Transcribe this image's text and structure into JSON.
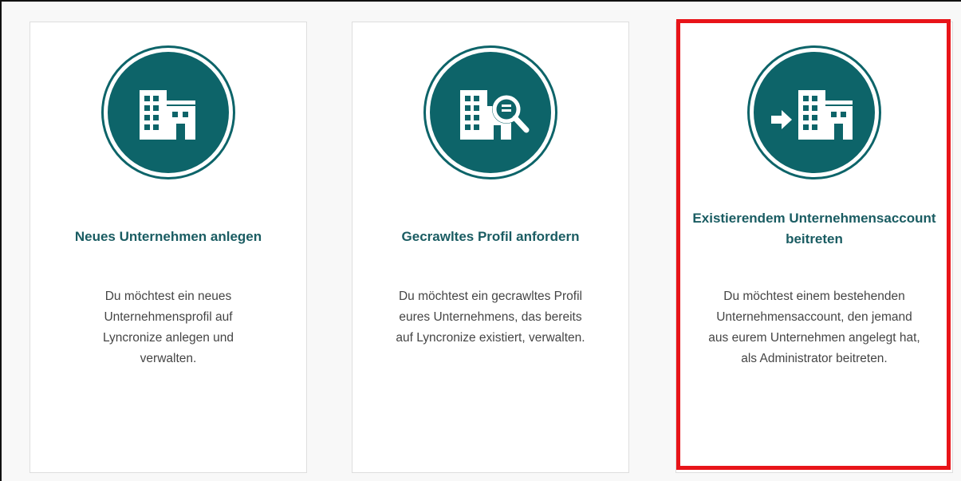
{
  "colors": {
    "accent": "#0d6469",
    "title": "#1a5c62",
    "highlight": "#e81419"
  },
  "cards": [
    {
      "icon": "company-building-icon",
      "title": "Neues Unternehmen anlegen",
      "description": "Du möchtest ein neues Unternehmensprofil auf Lyncronize anlegen und verwalten."
    },
    {
      "icon": "company-search-icon",
      "title": "Gecrawltes Profil anfordern",
      "description": "Du möchtest ein gecrawltes Profil eures Unternehmens, das bereits auf Lyncronize existiert, verwalten."
    },
    {
      "icon": "join-company-icon",
      "title": "Existierendem Unternehmensaccount beitreten",
      "description": "Du möchtest einem bestehenden Unternehmensaccount, den jemand aus eurem Unternehmen angelegt hat, als Administrator beitreten.",
      "highlighted": true
    }
  ]
}
